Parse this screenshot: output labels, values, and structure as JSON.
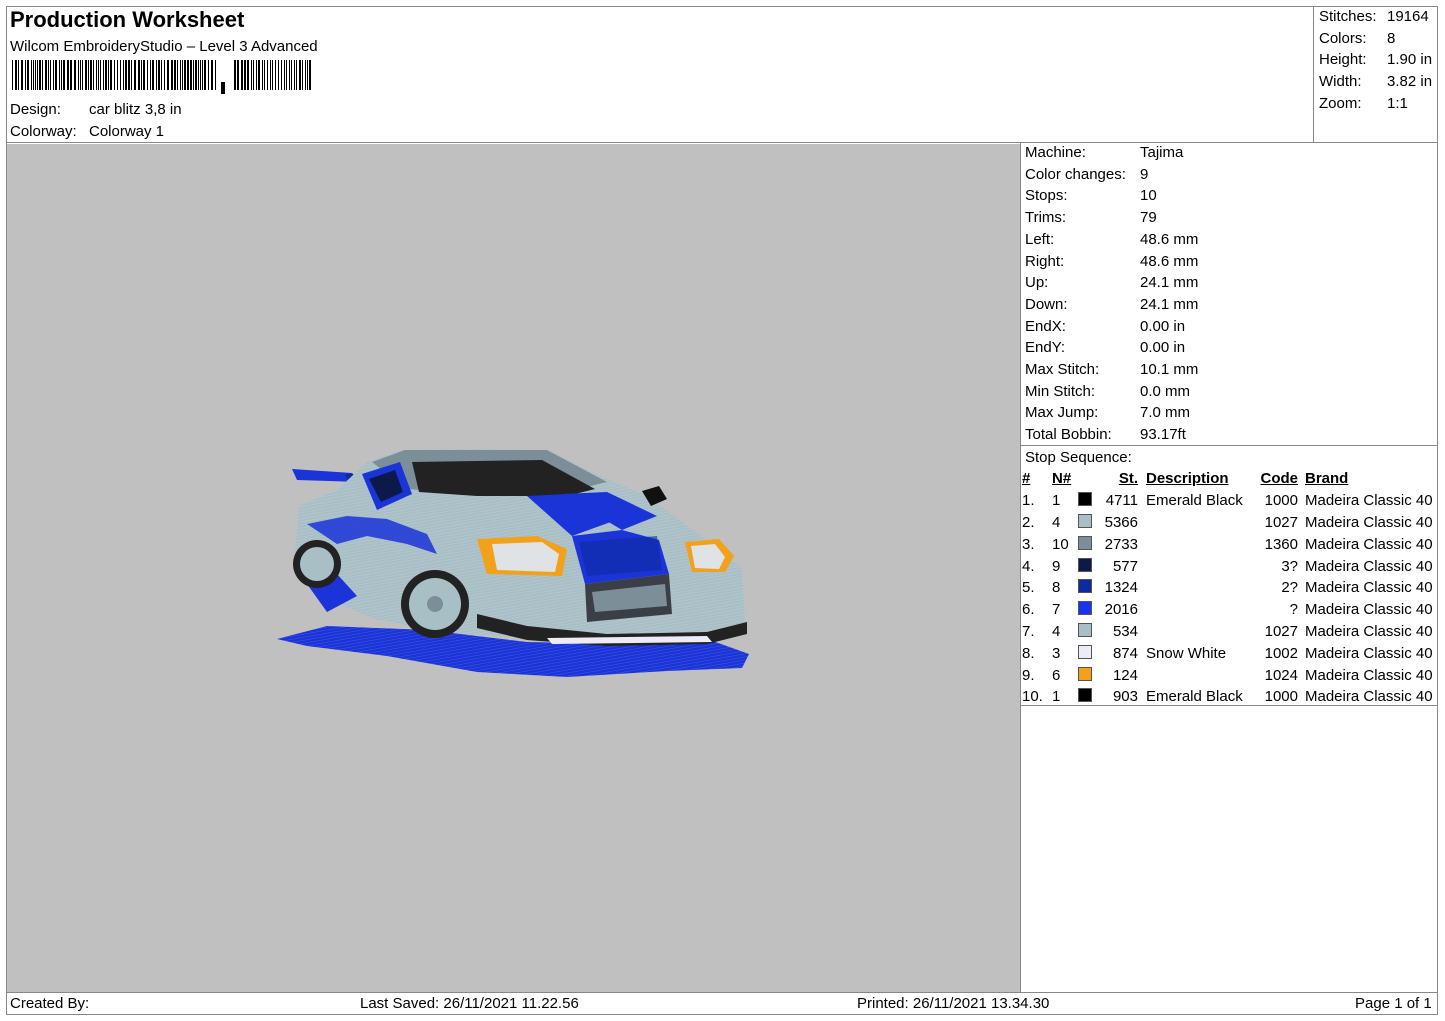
{
  "header": {
    "title": "Production Worksheet",
    "software": "Wilcom EmbroideryStudio – Level 3 Advanced",
    "design_label": "Design:",
    "design_value": "car blitz 3,8 in",
    "colorway_label": "Colorway:",
    "colorway_value": "Colorway 1"
  },
  "summary": [
    {
      "label": "Stitches:",
      "value": "19164"
    },
    {
      "label": "Colors:",
      "value": "8"
    },
    {
      "label": "Height:",
      "value": "1.90 in"
    },
    {
      "label": "Width:",
      "value": "3.82 in"
    },
    {
      "label": "Zoom:",
      "value": "1:1"
    }
  ],
  "machine_info": [
    {
      "label": "Machine:",
      "value": "Tajima"
    },
    {
      "label": "Color changes:",
      "value": "9"
    },
    {
      "label": "Stops:",
      "value": "10"
    },
    {
      "label": "Trims:",
      "value": "79"
    },
    {
      "label": "Left:",
      "value": "48.6 mm"
    },
    {
      "label": "Right:",
      "value": "48.6 mm"
    },
    {
      "label": "Up:",
      "value": "24.1 mm"
    },
    {
      "label": "Down:",
      "value": "24.1 mm"
    },
    {
      "label": "EndX:",
      "value": "0.00 in"
    },
    {
      "label": "EndY:",
      "value": "0.00 in"
    },
    {
      "label": "Max Stitch:",
      "value": "10.1 mm"
    },
    {
      "label": "Min Stitch:",
      "value": "0.0 mm"
    },
    {
      "label": "Max Jump:",
      "value": "7.0 mm"
    },
    {
      "label": "Total Bobbin:",
      "value": "93.17ft"
    }
  ],
  "stop_sequence": {
    "title": "Stop Sequence:",
    "headers": {
      "num": "#",
      "n": "N#",
      "st": "St.",
      "desc": "Description",
      "code": "Code",
      "brand": "Brand"
    },
    "rows": [
      {
        "num": "1.",
        "n": "1",
        "color": "#000000",
        "st": "4711",
        "desc": "Emerald Black",
        "code": "1000",
        "brand": "Madeira Classic 40"
      },
      {
        "num": "2.",
        "n": "4",
        "color": "#a9bfc6",
        "st": "5366",
        "desc": "",
        "code": "1027",
        "brand": "Madeira Classic 40"
      },
      {
        "num": "3.",
        "n": "10",
        "color": "#7c8f98",
        "st": "2733",
        "desc": "",
        "code": "1360",
        "brand": "Madeira Classic 40"
      },
      {
        "num": "4.",
        "n": "9",
        "color": "#0b1a4a",
        "st": "577",
        "desc": "",
        "code": "3?",
        "brand": "Madeira Classic 40"
      },
      {
        "num": "5.",
        "n": "8",
        "color": "#0e2aa0",
        "st": "1324",
        "desc": "",
        "code": "2?",
        "brand": "Madeira Classic 40"
      },
      {
        "num": "6.",
        "n": "7",
        "color": "#1534ef",
        "st": "2016",
        "desc": "",
        "code": "?",
        "brand": "Madeira Classic 40"
      },
      {
        "num": "7.",
        "n": "4",
        "color": "#a9bfc6",
        "st": "534",
        "desc": "",
        "code": "1027",
        "brand": "Madeira Classic 40"
      },
      {
        "num": "8.",
        "n": "3",
        "color": "#ecebf6",
        "st": "874",
        "desc": "Snow White",
        "code": "1002",
        "brand": "Madeira Classic 40"
      },
      {
        "num": "9.",
        "n": "6",
        "color": "#f2a11a",
        "st": "124",
        "desc": "",
        "code": "1024",
        "brand": "Madeira Classic 40"
      },
      {
        "num": "10.",
        "n": "1",
        "color": "#000000",
        "st": "903",
        "desc": "Emerald Black",
        "code": "1000",
        "brand": "Madeira Classic 40"
      }
    ]
  },
  "footer": {
    "created_by": "Created By:",
    "last_saved": "Last Saved: 26/11/2021 11.22.56",
    "printed": "Printed: 26/11/2021 13.34.30",
    "page": "Page 1 of 1"
  },
  "colors": {
    "canvas_bg": "#c0c0c0",
    "car_body": "#a9bfc6",
    "car_blue": "#1a34d8",
    "car_dark_blue": "#0e2aa0"
  }
}
